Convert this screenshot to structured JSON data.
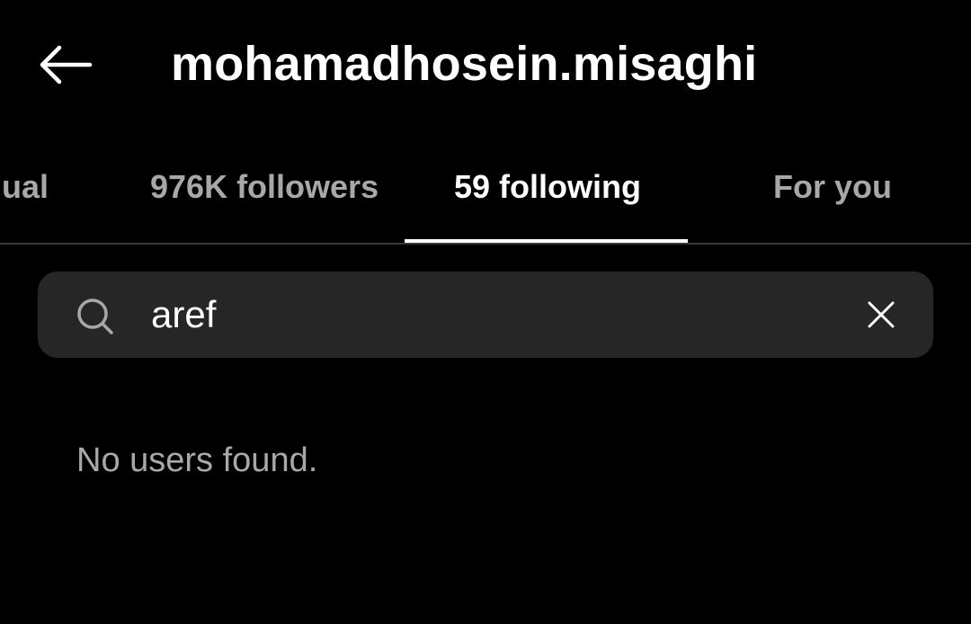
{
  "header": {
    "title": "mohamadhosein.misaghi",
    "back_icon": "arrow-left-icon"
  },
  "tabs": [
    {
      "label": "mutual",
      "visible_text": "ual",
      "active": false
    },
    {
      "label": "976K followers",
      "active": false
    },
    {
      "label": "59 following",
      "active": true
    },
    {
      "label": "For you",
      "active": false
    }
  ],
  "search": {
    "value": "aref",
    "icon": "search-icon",
    "clear_icon": "close-icon"
  },
  "results": {
    "empty_message": "No users found."
  },
  "colors": {
    "background": "#000000",
    "text_primary": "#ffffff",
    "text_secondary": "#a8a8a8",
    "search_background": "#262626",
    "divider": "#363636"
  }
}
